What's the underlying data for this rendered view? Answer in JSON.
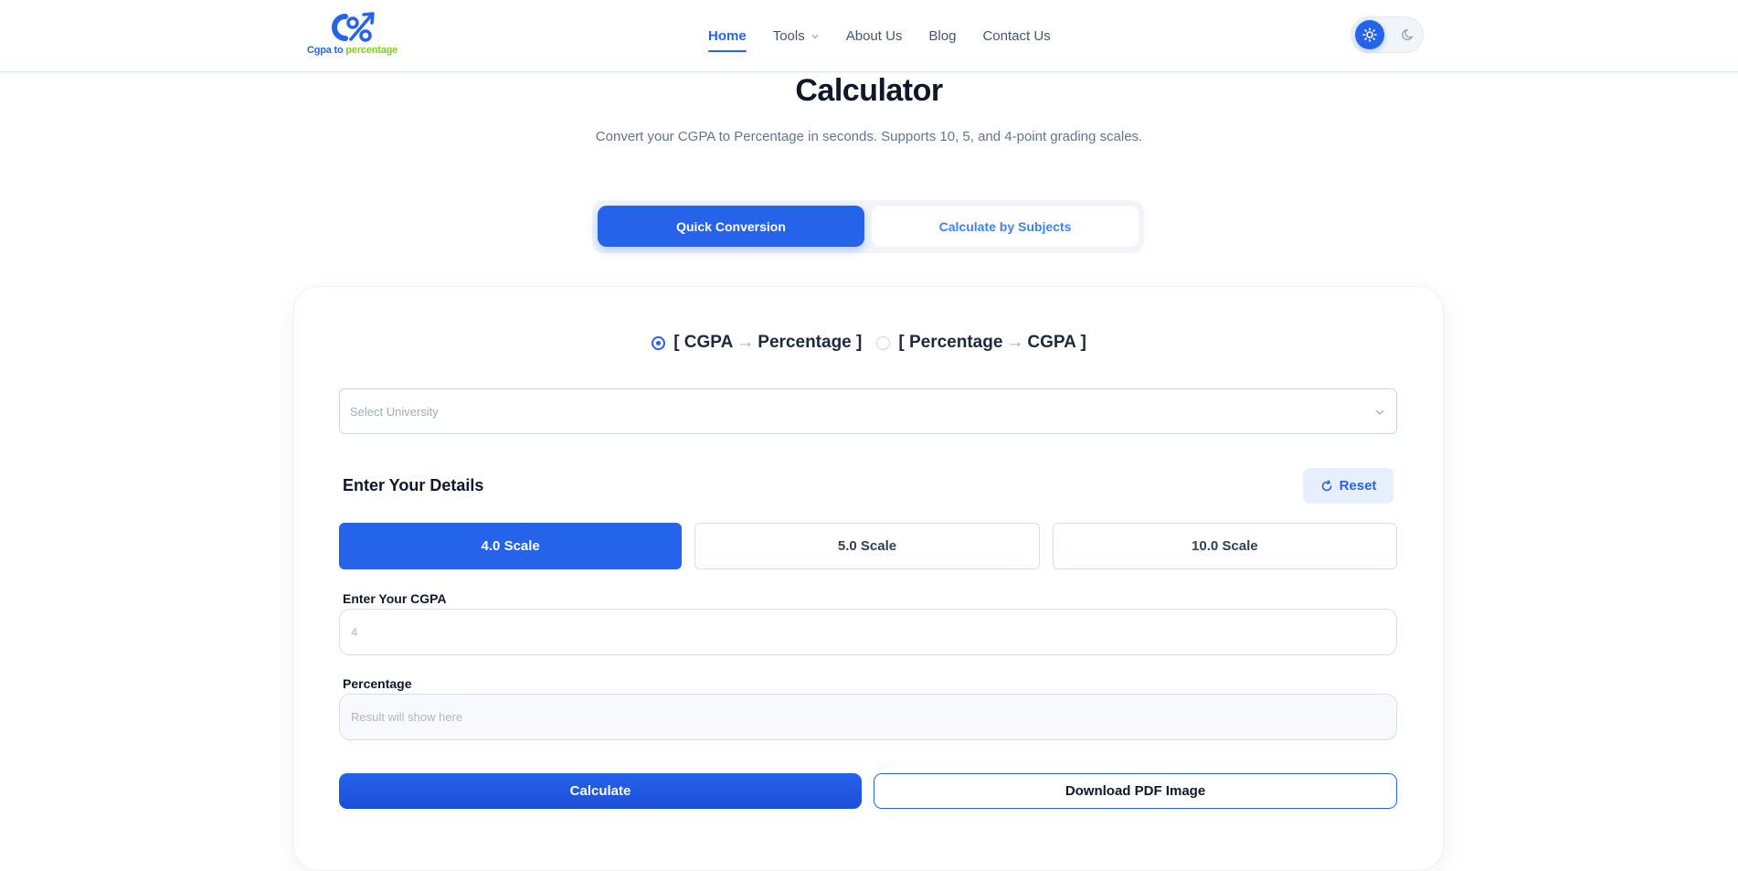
{
  "header": {
    "logo": {
      "text_part1": "Cgpa to ",
      "text_part2": "percentage",
      "color_primary": "#2563eb",
      "color_secondary": "#84cc16"
    },
    "nav": [
      {
        "label": "Home",
        "active": true
      },
      {
        "label": "Tools",
        "has_dropdown": true
      },
      {
        "label": "About Us"
      },
      {
        "label": "Blog"
      },
      {
        "label": "Contact Us"
      }
    ],
    "theme_toggle": {
      "selected": "light",
      "icons": [
        "sun-icon",
        "moon-icon"
      ]
    }
  },
  "main": {
    "title": "Calculator",
    "subtitle": "Convert your CGPA to Percentage in seconds. Supports 10, 5, and 4-point grading scales.",
    "mode_tabs": [
      {
        "label": "Quick Conversion",
        "active": true
      },
      {
        "label": "Calculate by Subjects",
        "active": false
      }
    ],
    "direction_options": [
      {
        "left": "[ CGPA",
        "right": "Percentage ]",
        "checked": true
      },
      {
        "left": "[ Percentage",
        "right": "CGPA ]",
        "checked": false
      }
    ],
    "university_select": {
      "placeholder": "Select University"
    },
    "details_title": "Enter Your Details",
    "reset_label": "Reset",
    "scales": [
      {
        "label": "4.0 Scale",
        "active": true
      },
      {
        "label": "5.0 Scale",
        "active": false
      },
      {
        "label": "10.0 Scale",
        "active": false
      }
    ],
    "cgpa_field": {
      "label": "Enter Your CGPA",
      "placeholder": "4"
    },
    "percentage_field": {
      "label": "Percentage",
      "placeholder": "Result will show here"
    },
    "calculate_label": "Calculate",
    "download_label": "Download PDF Image"
  },
  "colors": {
    "accent": "#2563eb",
    "text": "#0f172a",
    "muted": "#64748b"
  }
}
